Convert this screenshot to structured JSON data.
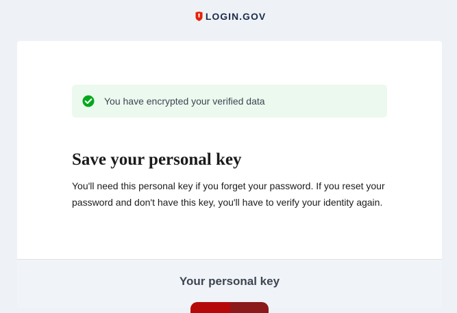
{
  "header": {
    "logo_text": "LOGIN.GOV",
    "logo_icon": "shield-icon",
    "brand_color": "#e52207"
  },
  "alert": {
    "icon": "check-circle-icon",
    "text": "You have encrypted your verified data",
    "status_color": "#00a91c"
  },
  "main": {
    "title": "Save your personal key",
    "description": "You'll need this personal key if you forget your password. If you reset your password and don't have this key, you'll have to verify your identity again."
  },
  "personal_key": {
    "heading": "Your personal key"
  }
}
